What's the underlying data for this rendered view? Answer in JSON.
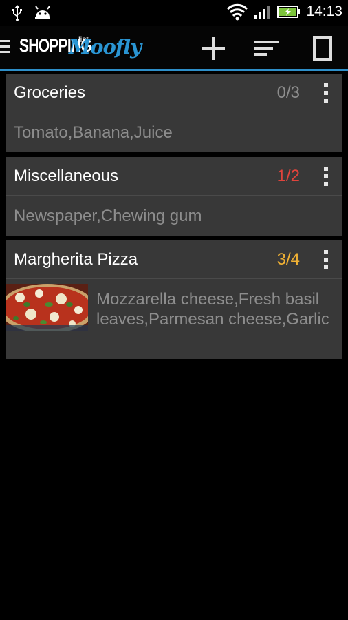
{
  "status_bar": {
    "time": "14:13",
    "icons": [
      "usb-icon",
      "android-icon",
      "wifi-icon",
      "signal-icon",
      "battery-charging-icon"
    ]
  },
  "app_bar": {
    "logo_main": "SHOPPING",
    "logo_small": "list",
    "logo_script": "Moofly",
    "actions": [
      "add-icon",
      "sort-icon",
      "square-icon"
    ],
    "accent_color": "#2e8fc9"
  },
  "lists": [
    {
      "title": "Groceries",
      "count": "0/3",
      "count_color": "#8d8d8d",
      "items_text": "Tomato,Banana,Juice",
      "has_image": false
    },
    {
      "title": "Miscellaneous",
      "count": "1/2",
      "count_color": "#e0443c",
      "items_text": "Newspaper,Chewing gum",
      "has_image": false
    },
    {
      "title": "Margherita Pizza",
      "count": "3/4",
      "count_color": "#f0b134",
      "items_text": "Mozzarella cheese,Fresh basil leaves,Parmesan cheese,Garlic",
      "has_image": true,
      "image_name": "pizza-thumbnail"
    }
  ]
}
